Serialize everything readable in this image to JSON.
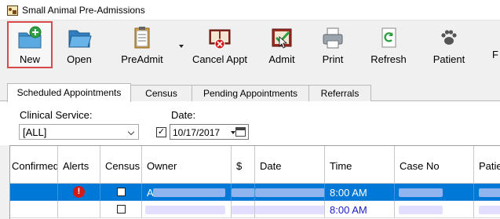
{
  "window": {
    "title": "Small Animal Pre-Admissions"
  },
  "toolbar": {
    "new_label": "New",
    "open_label": "Open",
    "preadmit_label": "PreAdmit",
    "cancel_appt_label": "Cancel Appt",
    "admit_label": "Admit",
    "print_label": "Print",
    "refresh_label": "Refresh",
    "patient_label": "Patient",
    "overflow_label": "F"
  },
  "tabs": [
    "Scheduled Appointments",
    "Census",
    "Pending Appointments",
    "Referrals"
  ],
  "filters": {
    "clinical_service_label": "Clinical Service:",
    "clinical_service_value": "[ALL]",
    "date_label": "Date:",
    "date_checked": true,
    "date_value": "10/17/2017"
  },
  "grid": {
    "columns": [
      "Confirmed",
      "Alerts",
      "Census",
      "Owner",
      "$",
      "Date",
      "Time",
      "Case No",
      "Patie"
    ],
    "rows": [
      {
        "selected": true,
        "alert": "!",
        "census_checked": false,
        "owner_initial": "A",
        "time": "8:00 AM"
      },
      {
        "selected": false,
        "alert": "",
        "census_checked": false,
        "owner_initial": "",
        "time": "8:00 AM"
      }
    ]
  },
  "colors": {
    "selection": "#0078d7",
    "highlight_border": "#d9484a",
    "alert_red": "#d51818",
    "time_text_blue": "#1a1acc"
  }
}
